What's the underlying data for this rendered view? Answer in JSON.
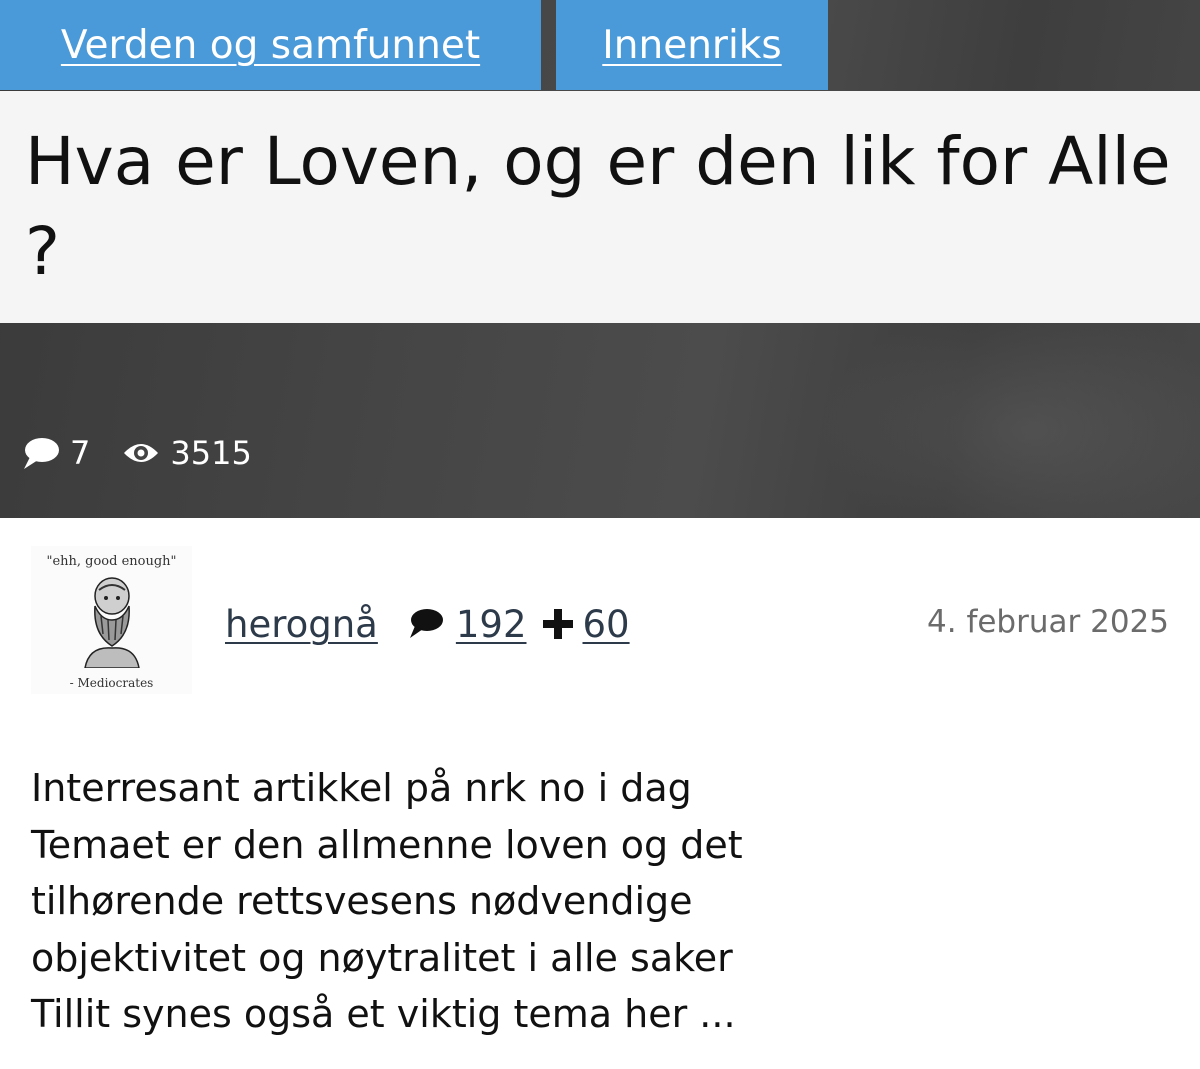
{
  "categories": [
    {
      "label": "Verden og samfunnet"
    },
    {
      "label": "Innenriks"
    }
  ],
  "article": {
    "title": "Hva er Loven, og er den lik for Alle ?",
    "comments_count": "7",
    "views_count": "3515"
  },
  "author": {
    "avatar_quote": "\"ehh, good enough\"",
    "avatar_caption": "- Mediocrates",
    "username": "herognå",
    "posts_count": "192",
    "plus_count": "60",
    "date": "4. februar 2025"
  },
  "body_lines": [
    "Interresant artikkel på nrk no i dag",
    "Temaet er den allmenne loven og det",
    "tilhørende rettsvesens nødvendige",
    "objektivitet og nøytralitet i alle saker",
    "Tillit synes også et viktig tema her ..."
  ],
  "icons": {
    "comment": "speech-bubble-icon",
    "views": "eye-icon",
    "plus": "plus-icon"
  },
  "colors": {
    "tag_background": "#4a9ad9",
    "hero_background": "#424242",
    "link": "#2d3a4a",
    "date": "#6b6b6b"
  }
}
